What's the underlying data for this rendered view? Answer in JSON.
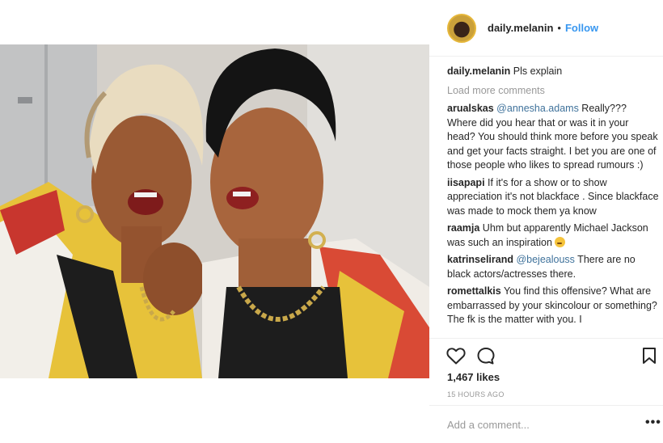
{
  "post": {
    "username": "daily.melanin",
    "follow_label": "Follow",
    "separator": "•"
  },
  "caption": {
    "username": "daily.melanin",
    "text": "Pls explain"
  },
  "load_more": "Load more comments",
  "comments": [
    {
      "username": "arualskas",
      "mention": "@annesha.adams",
      "text": " Really??? Where did you hear that or was it in your head? You should think more before you speak and get your facts straight. I bet you are one of those people who likes to spread rumours :)"
    },
    {
      "username": "iisapapi",
      "text": "If it's for a show or to show appreciation it's not blackface . Since blackface was made to mock them ya know"
    },
    {
      "username": "raamja",
      "text": "Uhm but apparently Michael Jackson was such an inspiration",
      "emoji": "thinking-face"
    },
    {
      "username": "katrinselirand",
      "mention": "@bejealouss",
      "text": " There are no black actors/actresses there."
    },
    {
      "username": "romettalkis",
      "text": "You find this offensive? What are embarrassed by your skincolour or something? The fk is the matter with you. I"
    }
  ],
  "likes": "1,467 likes",
  "time": "15 HOURS AGO",
  "add_comment_placeholder": "Add a comment...",
  "more_label": "•••",
  "icons": {
    "like": "heart-icon",
    "comment": "speech-bubble-icon",
    "save": "bookmark-icon"
  },
  "colors": {
    "follow": "#3897f0",
    "mention": "#3f729b",
    "muted": "#999999",
    "text": "#262626"
  }
}
